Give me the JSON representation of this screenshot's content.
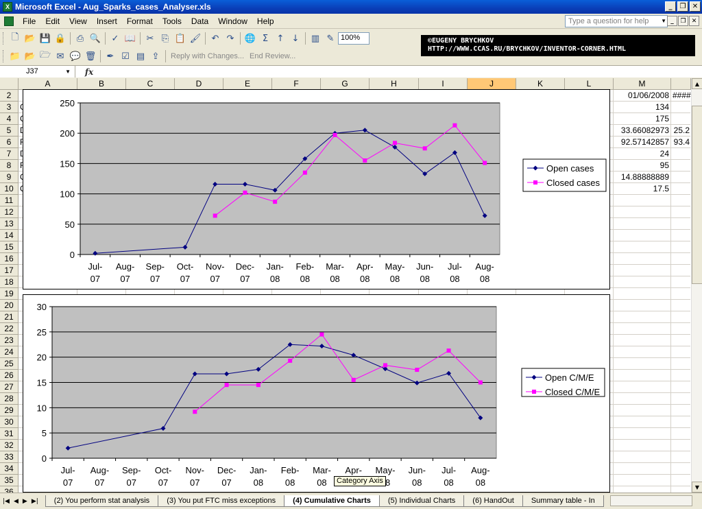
{
  "window": {
    "title": "Microsoft Excel - Aug_Sparks_cases_Analyser.xls",
    "app_icon": "X"
  },
  "menu": {
    "items": [
      "File",
      "Edit",
      "View",
      "Insert",
      "Format",
      "Tools",
      "Data",
      "Window",
      "Help"
    ],
    "help_placeholder": "Type a question for help"
  },
  "toolbar": {
    "zoom": "100%",
    "reply_label": "Reply with Changes...",
    "end_review_label": "End Review..."
  },
  "promo": {
    "line1": "©EUGENY BRYCHKOV",
    "line2": "HTTP://WWW.CCAS.RU/BRYCHKOV/INVENTOR-CORNER.HTML"
  },
  "formula_bar": {
    "name_box": "J37",
    "fx": "fx",
    "formula": ""
  },
  "grid": {
    "columns": [
      "A",
      "B",
      "C",
      "D",
      "E",
      "F",
      "G",
      "H",
      "I",
      "J",
      "K",
      "L",
      "M"
    ],
    "selected_column": "J",
    "rows": [
      "2",
      "3",
      "4",
      "5",
      "6",
      "7",
      "8",
      "9",
      "10",
      "11",
      "12",
      "13",
      "14",
      "15",
      "16",
      "17",
      "18",
      "19",
      "20",
      "21",
      "22",
      "23",
      "24",
      "25",
      "26",
      "27",
      "28",
      "29",
      "30",
      "31",
      "32",
      "33",
      "34",
      "35",
      "36"
    ],
    "col_m_values": [
      "01/06/2008",
      "134",
      "175",
      "33.66082973",
      "92.57142857",
      "24",
      "95",
      "14.88888889",
      "17.5"
    ],
    "col_n_values": [
      "####",
      "",
      "",
      "25.2",
      "93.4"
    ],
    "col_a_fragments": [
      "C",
      "C",
      "D",
      "F",
      "D",
      "F",
      "O",
      "O"
    ]
  },
  "charts": [
    {
      "type": "line",
      "categories": [
        "Jul-07",
        "Aug-07",
        "Sep-07",
        "Oct-07",
        "Nov-07",
        "Dec-07",
        "Jan-08",
        "Feb-08",
        "Mar-08",
        "Apr-08",
        "May-08",
        "Jun-08",
        "Jul-08",
        "Aug-08"
      ],
      "ylim": [
        0,
        250
      ],
      "yticks": [
        "0",
        "50",
        "100",
        "150",
        "200",
        "250"
      ],
      "series": [
        {
          "name": "Open cases",
          "color": "#000080",
          "marker": "diamond",
          "values": [
            2,
            null,
            null,
            12,
            116,
            116,
            106,
            158,
            200,
            205,
            177,
            133,
            168,
            64
          ]
        },
        {
          "name": "Closed cases",
          "color": "#FF00FF",
          "marker": "square",
          "values": [
            null,
            null,
            null,
            null,
            64,
            102,
            87,
            135,
            197,
            155,
            184,
            175,
            213,
            151
          ]
        }
      ]
    },
    {
      "type": "line",
      "categories": [
        "Jul-07",
        "Aug-07",
        "Sep-07",
        "Oct-07",
        "Nov-07",
        "Dec-07",
        "Jan-08",
        "Feb-08",
        "Mar-08",
        "Apr-08",
        "May-08",
        "Jun-08",
        "Jul-08",
        "Aug-08"
      ],
      "ylim": [
        0,
        30
      ],
      "yticks": [
        "0",
        "5",
        "10",
        "15",
        "20",
        "25",
        "30"
      ],
      "series": [
        {
          "name": "Open C/M/E",
          "color": "#000080",
          "marker": "diamond",
          "values": [
            2,
            null,
            null,
            5.9,
            16.7,
            16.7,
            17.6,
            22.5,
            22.2,
            20.4,
            17.7,
            14.9,
            16.8,
            8.0
          ]
        },
        {
          "name": "Closed C/M/E",
          "color": "#FF00FF",
          "marker": "square",
          "values": [
            null,
            null,
            null,
            null,
            9.2,
            14.5,
            14.5,
            19.3,
            24.5,
            15.5,
            18.4,
            17.5,
            21.3,
            15.0
          ]
        }
      ]
    }
  ],
  "tooltip": "Category Axis",
  "sheet_tabs": [
    {
      "label": "(2) You perform stat analysis",
      "active": false
    },
    {
      "label": "(3) You put FTC miss exceptions",
      "active": false
    },
    {
      "label": "(4) Cumulative Charts",
      "active": true
    },
    {
      "label": "(5) Individual Charts",
      "active": false
    },
    {
      "label": "(6) HandOut",
      "active": false
    },
    {
      "label": "Summary table - In",
      "active": false
    }
  ]
}
